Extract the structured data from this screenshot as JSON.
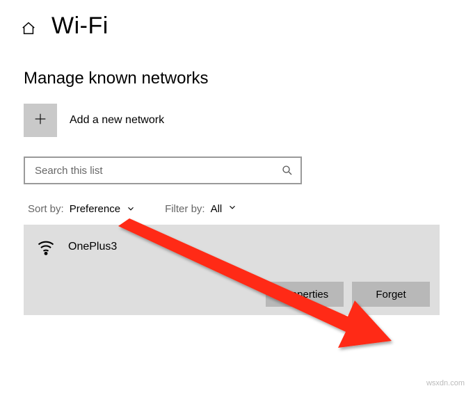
{
  "header": {
    "title": "Wi-Fi"
  },
  "section": {
    "heading": "Manage known networks"
  },
  "add_network": {
    "label": "Add a new network"
  },
  "search": {
    "placeholder": "Search this list"
  },
  "sort": {
    "label": "Sort by:",
    "value": "Preference"
  },
  "filter": {
    "label": "Filter by:",
    "value": "All"
  },
  "network": {
    "name": "OnePlus3",
    "properties_btn": "Properties",
    "forget_btn": "Forget"
  },
  "watermark": "wsxdn.com"
}
